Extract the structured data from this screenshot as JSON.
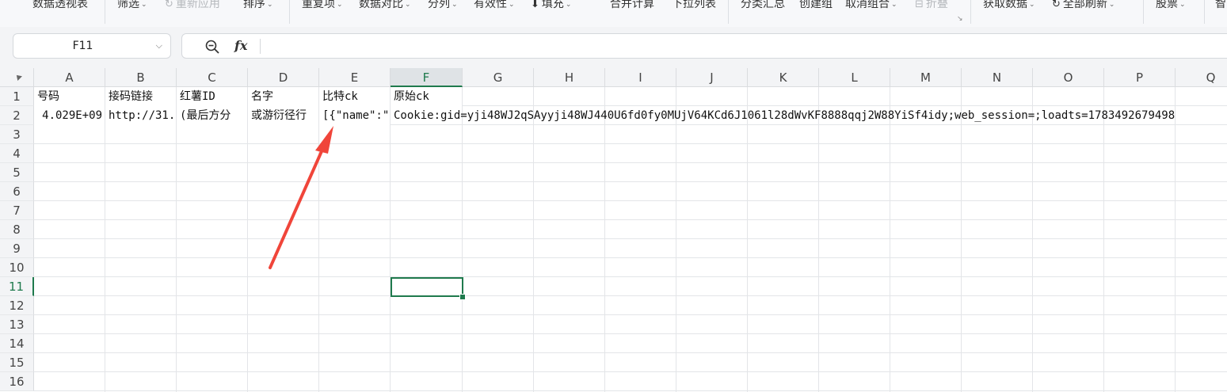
{
  "ribbon": {
    "pivot_table": "数据透视表",
    "filter": "筛选",
    "reapply": "重新应用",
    "sort": "排序",
    "duplicates": "重复项",
    "compare": "数据对比",
    "split_column": "分列",
    "validity": "有效性",
    "fill": "填充",
    "consolidate": "合并计算",
    "dropdown_list": "下拉列表",
    "subtotal": "分类汇总",
    "group": "创建组",
    "ungroup": "取消组合",
    "fold": "折叠",
    "get_data": "获取数据",
    "refresh_all": "全部刷新",
    "stocks": "股票",
    "smart": "智"
  },
  "formula_bar": {
    "cell_ref": "F11",
    "formula": ""
  },
  "columns": [
    "A",
    "B",
    "C",
    "D",
    "E",
    "F",
    "G",
    "H",
    "I",
    "J",
    "K",
    "L",
    "M",
    "N",
    "O",
    "P",
    "Q"
  ],
  "rows": [
    "1",
    "2",
    "3",
    "4",
    "5",
    "6",
    "7",
    "8",
    "9",
    "10",
    "11",
    "12",
    "13",
    "14",
    "15",
    "16"
  ],
  "selected_column": "F",
  "selected_row": "11",
  "cells": {
    "A1": "号码",
    "B1": "接码链接",
    "C1": "红薯ID",
    "D1": "名字",
    "E1": "比特ck",
    "F1": "原始ck",
    "A2": "4.029E+09",
    "B2": "http://31.",
    "C2": "(最后方分",
    "D2": "或游衍径行",
    "E2": "[{\"name\":\"",
    "F2": "Cookie:gid=yji48WJ2qSAyyji48WJ440U6fd0fy0MUjV64KCd6J1061l28dWvKF8888qqj2W88YiSf4idy;web_session=;loadts=1783492679498"
  },
  "colors": {
    "accent_green": "#1f7a4d",
    "arrow_red": "#f0453a"
  }
}
